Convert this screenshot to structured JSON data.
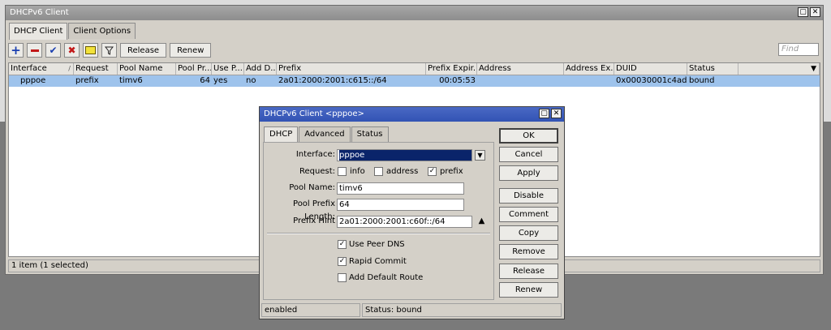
{
  "main_window": {
    "title": "DHCPv6 Client",
    "title_buttons": [
      "restore",
      "close"
    ],
    "tabs": [
      {
        "label": "DHCP Client",
        "active": true
      },
      {
        "label": "Client Options",
        "active": false
      }
    ],
    "toolbar": {
      "release_label": "Release",
      "renew_label": "Renew",
      "find_placeholder": "Find"
    },
    "table": {
      "columns": [
        "Interface",
        "Request",
        "Pool Name",
        "Pool Pr...",
        "Use P...",
        "Add D...",
        "Prefix",
        "Prefix Expir...",
        "Address",
        "Address Ex...",
        "DUID",
        "Status"
      ],
      "rows": [
        {
          "interface": "pppoe",
          "request": "prefix",
          "pool_name": "timv6",
          "pool_prefix": "64",
          "use_peer": "yes",
          "add_default": "no",
          "prefix": "2a01:2000:2001:c615::/64",
          "prefix_expires": "00:05:53",
          "address": "",
          "address_expires": "",
          "duid": "0x00030001c4ad...",
          "status": "bound"
        }
      ]
    },
    "status_text": "1 item (1 selected)"
  },
  "dialog": {
    "title": "DHCPv6 Client <pppoe>",
    "tabs": [
      {
        "label": "DHCP",
        "active": true
      },
      {
        "label": "Advanced",
        "active": false
      },
      {
        "label": "Status",
        "active": false
      }
    ],
    "fields": {
      "interface_label": "Interface:",
      "interface_value": "pppoe",
      "request_label": "Request:",
      "request_options": [
        {
          "label": "info",
          "checked": false
        },
        {
          "label": "address",
          "checked": false
        },
        {
          "label": "prefix",
          "checked": true
        }
      ],
      "pool_name_label": "Pool Name:",
      "pool_name_value": "timv6",
      "pool_prefix_length_label": "Pool Prefix Length:",
      "pool_prefix_length_value": "64",
      "prefix_hint_label": "Prefix Hint",
      "prefix_hint_value": "2a01:2000:2001:c60f::/64"
    },
    "checkboxes": [
      {
        "label": "Use Peer DNS",
        "checked": true
      },
      {
        "label": "Rapid Commit",
        "checked": true
      },
      {
        "label": "Add Default Route",
        "checked": false
      }
    ],
    "buttons": [
      "OK",
      "Cancel",
      "Apply",
      "Disable",
      "Comment",
      "Copy",
      "Remove",
      "Release",
      "Renew"
    ],
    "status_left": "enabled",
    "status_right": "Status: bound"
  }
}
